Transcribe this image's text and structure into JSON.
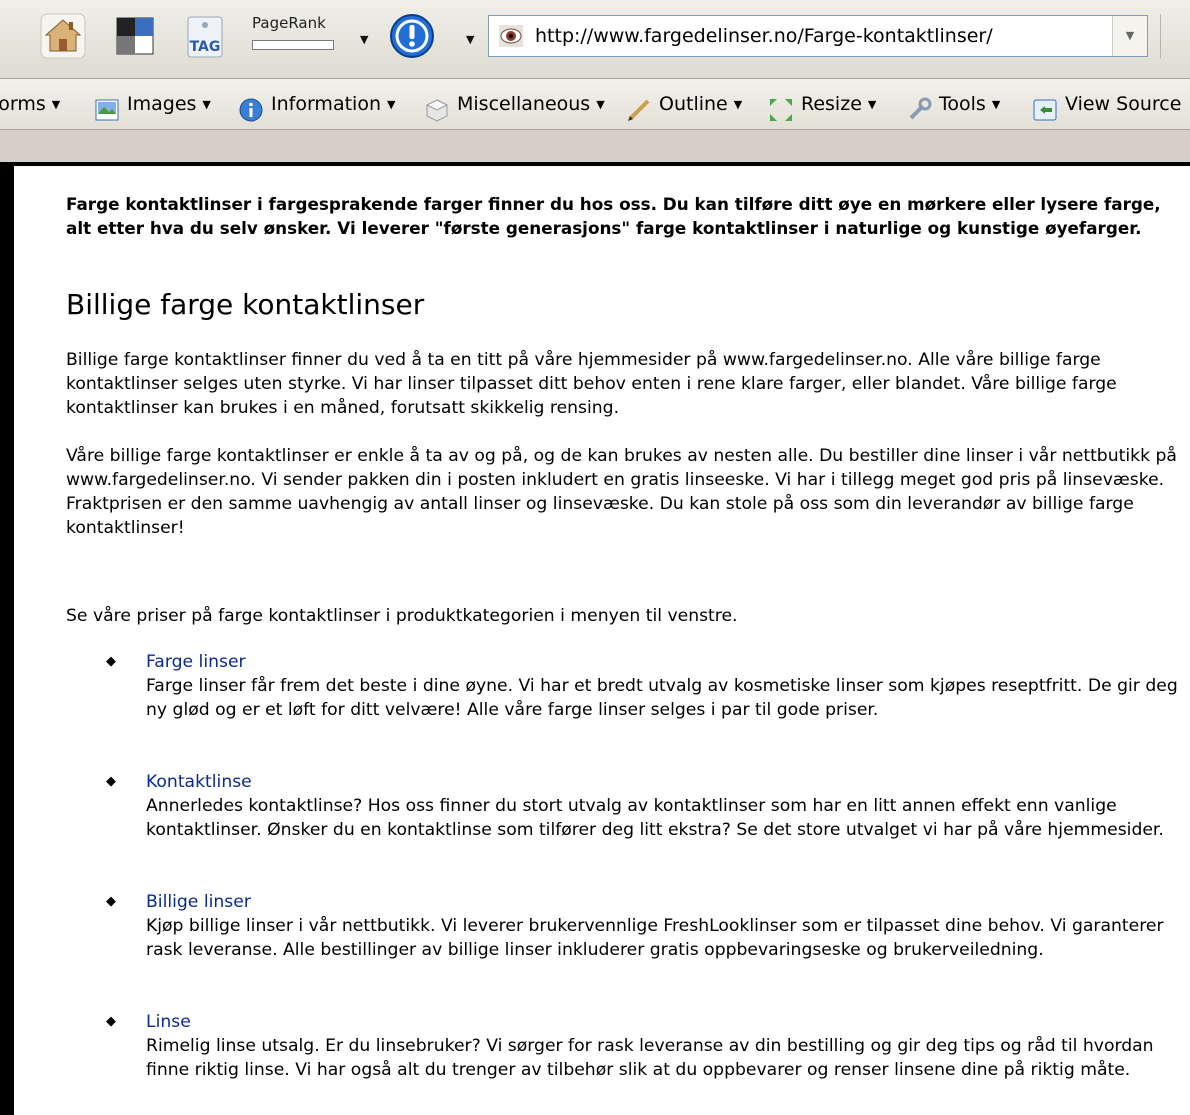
{
  "toolbar": {
    "pagerank_label": "PageRank",
    "tag_label": "TAG",
    "url": "http://www.fargedelinser.no/Farge-kontaktlinser/"
  },
  "devtoolbar": {
    "items": [
      {
        "label": "Forms",
        "icon": "forms-icon"
      },
      {
        "label": "Images",
        "icon": "images-icon"
      },
      {
        "label": "Information",
        "icon": "information-icon"
      },
      {
        "label": "Miscellaneous",
        "icon": "miscellaneous-icon"
      },
      {
        "label": "Outline",
        "icon": "outline-icon"
      },
      {
        "label": "Resize",
        "icon": "resize-icon"
      },
      {
        "label": "Tools",
        "icon": "tools-icon"
      },
      {
        "label": "View Source",
        "icon": "view-source-icon"
      }
    ]
  },
  "page": {
    "intro": "Farge kontaktlinser i fargesprakende farger finner du hos oss. Du kan tilføre ditt øye en mørkere eller lysere farge, alt etter hva du selv ønsker. Vi leverer \"første generasjons\" farge kontaktlinser i naturlige og kunstige øyefarger.",
    "heading": "Billige farge kontaktlinser",
    "paragraph1": "Billige farge kontaktlinser finner du ved å ta en titt på våre hjemmesider på www.fargedelinser.no. Alle våre billige farge kontaktlinser selges uten styrke. Vi har linser tilpasset ditt behov enten i rene klare farger, eller blandet. Våre billige farge kontaktlinser kan brukes i en måned, forutsatt skikkelig rensing.",
    "paragraph2": "Våre billige farge kontaktlinser er enkle å ta av og på, og de kan brukes av nesten alle. Du bestiller dine linser i vår nettbutikk på www.fargedelinser.no. Vi sender pakken din i posten inkludert en gratis linseeske. Vi har i tillegg meget god pris på linsevæske. Fraktprisen er den samme uavhengig av antall linser og linsevæske. Du kan stole på oss som din leverandør av billige farge kontaktlinser!",
    "paragraph3": "Se våre priser på farge kontaktlinser i produktkategorien i menyen til venstre.",
    "list": [
      {
        "link": "Farge linser",
        "desc": "Farge linser får frem det beste i dine øyne. Vi har et bredt utvalg av kosmetiske linser som kjøpes reseptfritt. De gir deg ny glød og er et løft for ditt velvære! Alle våre farge linser selges i par til gode priser."
      },
      {
        "link": "Kontaktlinse",
        "desc": "Annerledes kontaktlinse? Hos oss finner du stort utvalg av kontaktlinser som har en litt annen effekt enn vanlige kontaktlinser. Ønsker du en kontaktlinse som tilfører deg litt ekstra? Se det store utvalget vi har på våre hjemmesider."
      },
      {
        "link": "Billige linser",
        "desc": "Kjøp billige linser i vår nettbutikk. Vi leverer brukervennlige FreshLooklinser som er tilpasset dine behov. Vi garanterer rask leveranse. Alle bestillinger av billige linser inkluderer gratis oppbevaringseske og brukerveiledning."
      },
      {
        "link": "Linse",
        "desc": "Rimelig linse utsalg. Er du linsebruker? Vi sørger for rask leveranse av din bestilling og gir deg tips og råd til hvordan finne riktig linse. Vi har også alt du trenger av tilbehør slik at du oppbevarer og renser linsene dine på riktig måte."
      }
    ]
  },
  "colors": {
    "link": "#0a2a8c",
    "alert": "#1f6fd6"
  }
}
